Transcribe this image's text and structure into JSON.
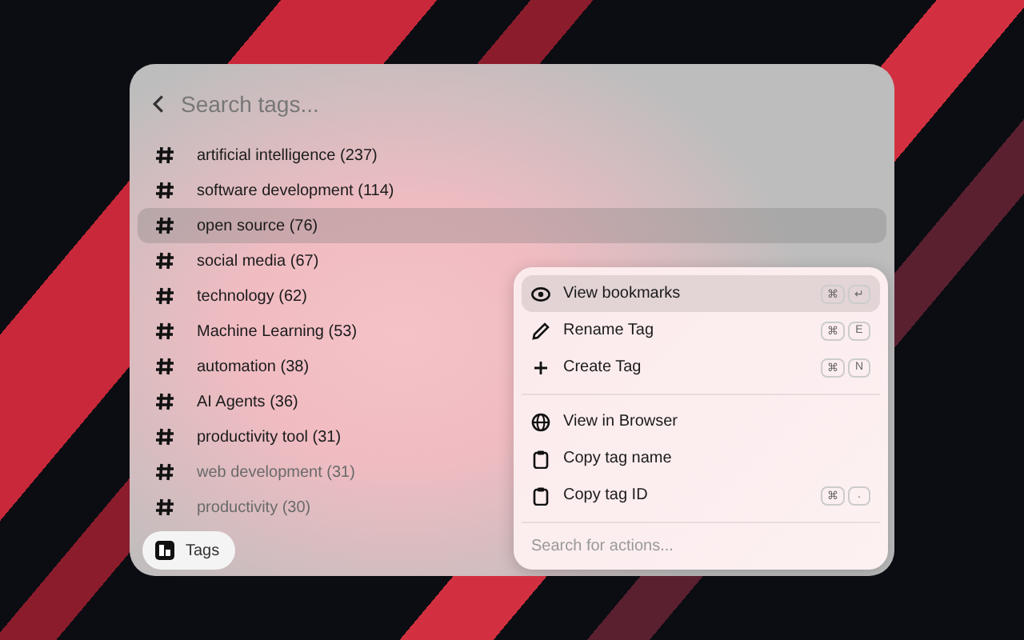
{
  "search": {
    "placeholder": "Search tags..."
  },
  "tags": [
    {
      "label": "artificial intelligence (237)",
      "selected": false
    },
    {
      "label": "software development (114)",
      "selected": false
    },
    {
      "label": "open source (76)",
      "selected": true
    },
    {
      "label": "social media (67)",
      "selected": false
    },
    {
      "label": "technology (62)",
      "selected": false
    },
    {
      "label": "Machine Learning (53)",
      "selected": false
    },
    {
      "label": "automation (38)",
      "selected": false
    },
    {
      "label": "AI Agents (36)",
      "selected": false
    },
    {
      "label": "productivity tool (31)",
      "selected": false
    },
    {
      "label": "web development (31)",
      "selected": false
    },
    {
      "label": "productivity (30)",
      "selected": false
    }
  ],
  "footer": {
    "label": "Tags"
  },
  "actions": {
    "groups": [
      [
        {
          "kind": "view",
          "label": "View bookmarks",
          "keys": [
            "⌘",
            "↵"
          ],
          "selected": true
        },
        {
          "kind": "rename",
          "label": "Rename Tag",
          "keys": [
            "⌘",
            "E"
          ],
          "selected": false
        },
        {
          "kind": "create",
          "label": "Create Tag",
          "keys": [
            "⌘",
            "N"
          ],
          "selected": false
        }
      ],
      [
        {
          "kind": "browser",
          "label": "View in Browser",
          "selected": false
        },
        {
          "kind": "copy",
          "label": "Copy tag name",
          "selected": false
        },
        {
          "kind": "copy",
          "label": "Copy tag ID",
          "keys": [
            "⌘",
            "."
          ],
          "selected": false
        }
      ]
    ],
    "search": {
      "placeholder": "Search for actions..."
    }
  }
}
